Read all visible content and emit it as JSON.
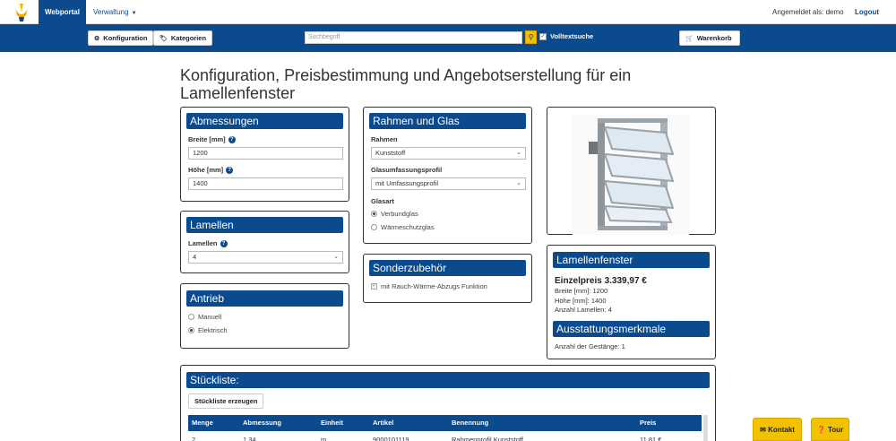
{
  "nav": {
    "active": "Webportal",
    "menu": "Verwaltung",
    "login_status": "Angemeldet als: demo",
    "logout": "Logout"
  },
  "toolbar": {
    "config": "Konfiguration",
    "categories": "Kategorien",
    "search_placeholder": "Suchbegriff",
    "fulltext": "Volltextsuche",
    "cart": "Warenkorb"
  },
  "page": {
    "title": "Konfiguration, Preisbestimmung und Angebotserstellung für ein Lamellenfenster"
  },
  "abmessungen": {
    "title": "Abmessungen",
    "width_label": "Breite [mm]",
    "width_value": "1200",
    "height_label": "Höhe [mm]",
    "height_value": "1400"
  },
  "lamellen": {
    "title": "Lamellen",
    "label": "Lamellen",
    "value": "4"
  },
  "antrieb": {
    "title": "Antrieb",
    "options": [
      "Manuell",
      "Elektrisch"
    ],
    "selected": "Elektrisch"
  },
  "rahmen": {
    "title": "Rahmen und Glas",
    "frame_label": "Rahmen",
    "frame_value": "Kunststoff",
    "profile_label": "Glasumfassungsprofil",
    "profile_value": "mit Umfassungsprofil",
    "glass_label": "Glasart",
    "glass_options": [
      "Verbundglas",
      "Wärmeschutzglas"
    ],
    "glass_selected": "Verbundglas"
  },
  "sonderzubehoer": {
    "title": "Sonderzubehör",
    "option": "mit Rauch-Wärme-Abzugs Funktion"
  },
  "summary": {
    "title": "Lamellenfenster",
    "price": "Einzelpreis 3.339,97 €",
    "width": "Breite [mm]: 1200",
    "height": "Höhe [mm]: 1400",
    "lamellen": "Anzahl Lamellen: 4",
    "features_title": "Ausstattungsmerkmale",
    "gaenge": "Anzahl der Gestänge: 1"
  },
  "stueckliste": {
    "title": "Stückliste:",
    "button": "Stückliste erzeugen",
    "headers": [
      "Menge",
      "Abmessung",
      "Einheit",
      "Artikel",
      "Benennung",
      "Preis"
    ],
    "rows": [
      [
        "2",
        "1,34",
        "m",
        "9000101119",
        "Rahmenprofil Kunststoff",
        "11,81 €"
      ]
    ]
  },
  "floating": {
    "contact": "Kontakt",
    "tour": "Tour"
  },
  "colors": {
    "primary": "#0b4a8c",
    "accent": "#f2c200"
  }
}
